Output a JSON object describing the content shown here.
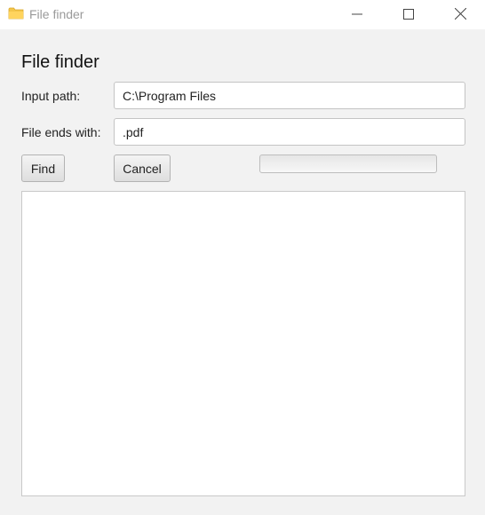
{
  "window": {
    "title": "File finder",
    "icon": "folder-icon",
    "controls": [
      "minimize-icon",
      "maximize-icon",
      "close-icon"
    ]
  },
  "form": {
    "heading": "File finder",
    "input_path_label": "Input path:",
    "input_path_value": "C:\\Program Files",
    "file_ends_label": "File ends with:",
    "file_ends_value": ".pdf"
  },
  "actions": {
    "find_label": "Find",
    "cancel_label": "Cancel"
  },
  "progress": {
    "fraction": 0
  },
  "results": {
    "text": ""
  },
  "colors": {
    "window_background": "#f2f2f2",
    "titlebar": "#ffffff",
    "folder_icon": "#f4c64a"
  }
}
